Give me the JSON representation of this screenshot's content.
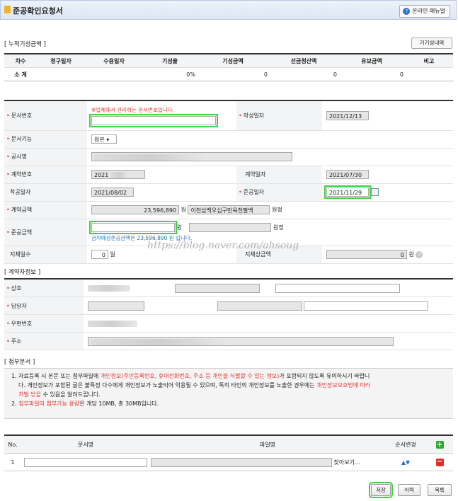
{
  "window": {
    "title": "준공확인요청서",
    "manual_label": "온라인 매뉴얼"
  },
  "progress_section": {
    "heading": "[ 누적기성금액 ]",
    "history_button": "기기성내역",
    "columns": [
      "차수",
      "청구일자",
      "수용일자",
      "기성율",
      "기성금액",
      "선금청산액",
      "유보금액",
      "비고"
    ],
    "sum_row": {
      "label": "소 계",
      "rate": "0%",
      "amount": "0",
      "advance": "0",
      "retention": "0"
    }
  },
  "form": {
    "doc_no": {
      "label": "문서번호",
      "note": "※업체에서 관리하는 문서번호입니다.",
      "value": ""
    },
    "written_date": {
      "label": "작성일자",
      "value": "2021/12/13"
    },
    "doc_function": {
      "label": "문서기능",
      "value": "원본"
    },
    "project_name": {
      "label": "공사명",
      "value": ""
    },
    "contract_no": {
      "label": "계약번호",
      "value": "2021"
    },
    "contract_date": {
      "label": "계약일자",
      "value": "2021/07/30"
    },
    "start_date": {
      "label": "착공일자",
      "value": "2021/08/02"
    },
    "completion_date": {
      "label": "준공일자",
      "value": "2021/11/29"
    },
    "contract_amount": {
      "label": "계약금액",
      "value": "23,596,890",
      "unit": "원",
      "korean": "이천삼백오십구만육천팔백",
      "korean_unit": "원정"
    },
    "completion_amount": {
      "label": "준공금액",
      "value": "",
      "unit": "원",
      "korean_unit": "원정",
      "note": "금차예상준공금액은 23,596,890 원 입니다."
    },
    "delay_days": {
      "label": "지체일수",
      "value": "0",
      "unit": "일"
    },
    "delay_penalty": {
      "label": "지체상금액",
      "value": "0",
      "unit": "원"
    }
  },
  "watermark": "https://blog.naver.com/ahsoug",
  "contractor_section": {
    "heading": "[ 계약자정보 ]",
    "fields": [
      "상호",
      "담당자",
      "우편번호",
      "주소"
    ]
  },
  "attachment_section": {
    "heading": "[ 첨부문서 ]",
    "notice_1a": "1. 자료등록 시 본문 또는 첨부파일에 ",
    "notice_1b": "개인정보(주민등록번호, 휴대전화번호, 주소 등 개인을 식별할 수 있는 정보)",
    "notice_1c": "가 포함되지 않도록 유의하시기 바랍니",
    "notice_1d": "다. 개인정보가 포함된 글은 불특정 다수에게 개인정보가 노출되어 악용될 수 있으며, 특히 타인의 개인정보를 노출한 경우에는 ",
    "notice_1e": "개인정보보호법에 따라",
    "notice_1f": "처벌 받을",
    "notice_1g": " 수 있음을 알려드립니다.",
    "notice_2a": "2. ",
    "notice_2b": "첨부파일의 첨부가능 용량",
    "notice_2c": "은 개당 10MB, 총 30MB입니다.",
    "columns": {
      "no": "No.",
      "doc_name": "문서명",
      "file_name": "파일명",
      "order": "순서변경"
    },
    "rows": [
      {
        "no": "1",
        "browse": "찾아보기..."
      }
    ],
    "order_glyph": "▲▼",
    "add_glyph": "+",
    "remove_glyph": "−"
  },
  "footer": {
    "save": "저장",
    "history": "이력",
    "list": "목록"
  }
}
